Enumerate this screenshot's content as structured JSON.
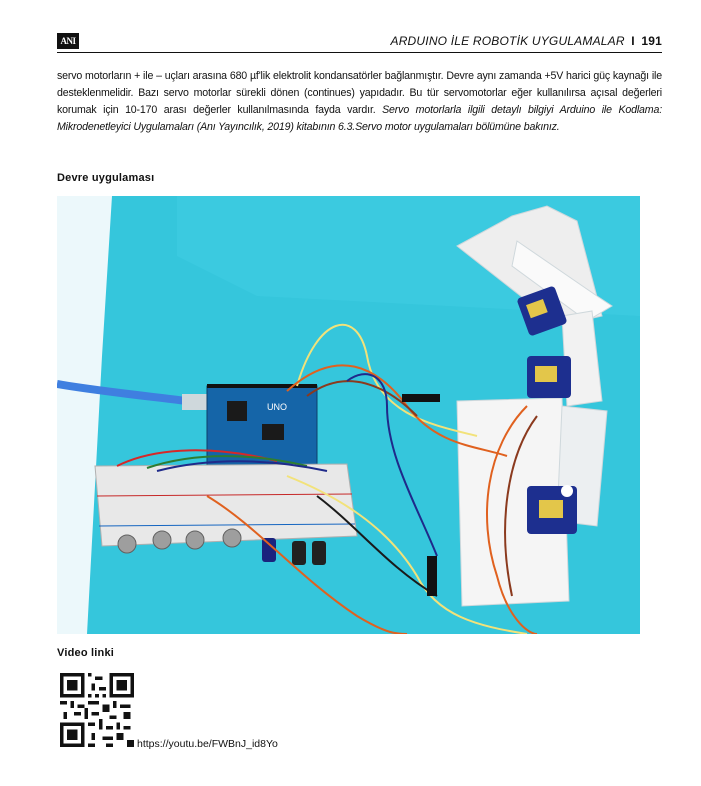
{
  "header": {
    "logo_text": "ANI",
    "title": "ARDUINO İLE ROBOTİK UYGULAMALAR",
    "separator": "I",
    "page_number": "191"
  },
  "body": {
    "paragraph_regular": "servo motorların + ile – uçları arasına 680 µf'lik elektrolit kondansatörler bağlanmıştır. Devre aynı zamanda +5V harici güç kaynağı ile desteklenmelidir. Bazı servo motorlar sürekli dönen (continues) yapıdadır. Bu tür servomotorlar eğer kullanılırsa açısal değerleri korumak için 10-170 arası değerler kullanılmasında fayda vardır. ",
    "paragraph_italic": "Servo motorlarla ilgili detaylı bilgiyi Arduino ile Kodlama: Mikrodenetleyici Uygulamaları (Anı Yayıncılık, 2019) kitabının 6.3.Servo motor uygulamaları bölümüne bakınız."
  },
  "sections": {
    "circuit_heading": "Devre uygulaması",
    "video_heading": "Video linki"
  },
  "photo": {
    "board_label": "UNO",
    "background_color": "#35c6dc",
    "wire_colors": [
      "#f2e27a",
      "#e0611f",
      "#8b3a1e",
      "#1f2a8a",
      "#1a1a1a",
      "#d62828"
    ]
  },
  "video": {
    "url": "https://youtu.be/FWBnJ_id8Yo"
  }
}
